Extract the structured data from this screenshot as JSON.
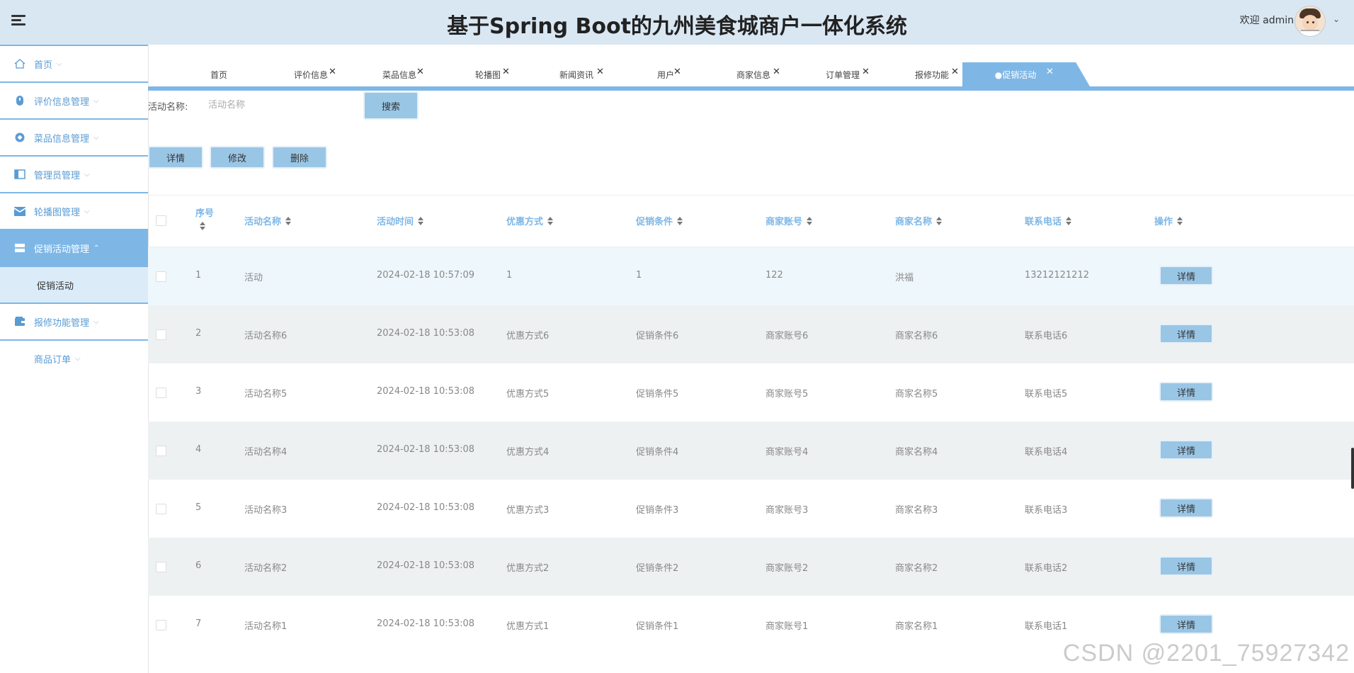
{
  "header": {
    "title": "基于Spring Boot的九州美食城商户一体化系统",
    "welcome": "欢迎 admin",
    "chevron": "⌄"
  },
  "sidebar": {
    "items": [
      {
        "label": "首页",
        "icon": "home-icon"
      },
      {
        "label": "评价信息管理",
        "icon": "comment-icon"
      },
      {
        "label": "菜品信息管理",
        "icon": "dish-icon"
      },
      {
        "label": "管理员管理",
        "icon": "admin-icon"
      },
      {
        "label": "轮播图管理",
        "icon": "mail-icon"
      },
      {
        "label": "促销活动管理",
        "icon": "promo-icon",
        "active": true
      },
      {
        "label": "报修功能管理",
        "icon": "wallet-icon"
      }
    ],
    "sub_item": "促销活动",
    "plain_item": "商品订单",
    "chevron_down": "⌵",
    "chevron_up": "⌃"
  },
  "tabs": [
    {
      "label": "首页",
      "closable": false
    },
    {
      "label": "评价信息",
      "closable": true
    },
    {
      "label": "菜品信息",
      "closable": true
    },
    {
      "label": "轮播图",
      "closable": true
    },
    {
      "label": "新闻资讯",
      "closable": true
    },
    {
      "label": "用户",
      "closable": true
    },
    {
      "label": "商家信息",
      "closable": true
    },
    {
      "label": "订单管理",
      "closable": true
    },
    {
      "label": "报修功能",
      "closable": true
    },
    {
      "label": "●促销活动",
      "closable": true,
      "active": true
    }
  ],
  "tab_close": "✕",
  "search": {
    "label": "活动名称:",
    "placeholder": "活动名称",
    "button": "搜索"
  },
  "actions": {
    "detail": "详情",
    "edit": "修改",
    "delete": "删除"
  },
  "table": {
    "columns": [
      "序号",
      "活动名称",
      "活动时间",
      "优惠方式",
      "促销条件",
      "商家账号",
      "商家名称",
      "联系电话",
      "操作"
    ],
    "row_button": "详情",
    "rows": [
      {
        "no": "1",
        "name": "活动",
        "time": "2024-02-18 10:57:09",
        "discount": "1",
        "condition": "1",
        "account": "122",
        "merchant": "洪福",
        "phone": "13212121212"
      },
      {
        "no": "2",
        "name": "活动名称6",
        "time": "2024-02-18 10:53:08",
        "discount": "优惠方式6",
        "condition": "促销条件6",
        "account": "商家账号6",
        "merchant": "商家名称6",
        "phone": "联系电话6"
      },
      {
        "no": "3",
        "name": "活动名称5",
        "time": "2024-02-18 10:53:08",
        "discount": "优惠方式5",
        "condition": "促销条件5",
        "account": "商家账号5",
        "merchant": "商家名称5",
        "phone": "联系电话5"
      },
      {
        "no": "4",
        "name": "活动名称4",
        "time": "2024-02-18 10:53:08",
        "discount": "优惠方式4",
        "condition": "促销条件4",
        "account": "商家账号4",
        "merchant": "商家名称4",
        "phone": "联系电话4"
      },
      {
        "no": "5",
        "name": "活动名称3",
        "time": "2024-02-18 10:53:08",
        "discount": "优惠方式3",
        "condition": "促销条件3",
        "account": "商家账号3",
        "merchant": "商家名称3",
        "phone": "联系电话3"
      },
      {
        "no": "6",
        "name": "活动名称2",
        "time": "2024-02-18 10:53:08",
        "discount": "优惠方式2",
        "condition": "促销条件2",
        "account": "商家账号2",
        "merchant": "商家名称2",
        "phone": "联系电话2"
      },
      {
        "no": "7",
        "name": "活动名称1",
        "time": "2024-02-18 10:53:08",
        "discount": "优惠方式1",
        "condition": "促销条件1",
        "account": "商家账号1",
        "merchant": "商家名称1",
        "phone": "联系电话1"
      }
    ]
  },
  "watermark": "CSDN @2201_75927342",
  "colors": {
    "header_bg": "#d9e7f3",
    "accent": "#7eb7e6",
    "button": "#9ac6e6",
    "row_highlight": "#eef7fc",
    "row_alt": "#eef1f2"
  }
}
